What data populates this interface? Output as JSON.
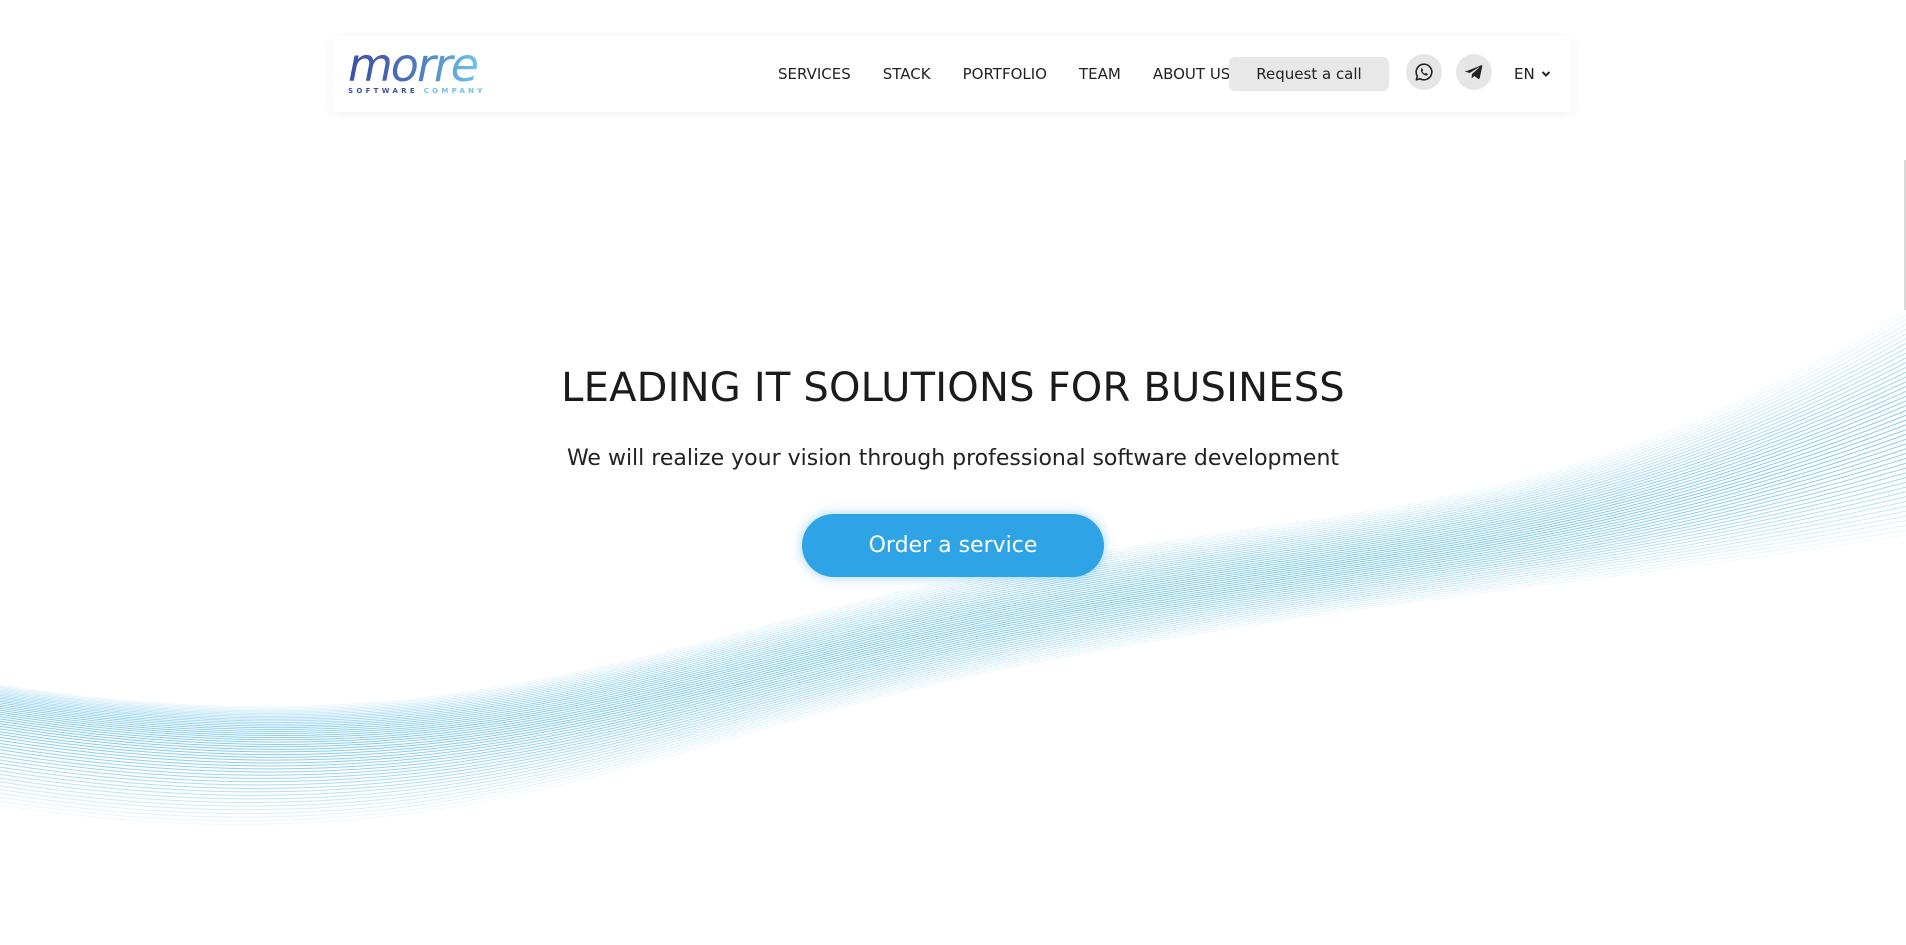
{
  "header": {
    "logo": {
      "word": "morre",
      "tagline_part1": "SOFTWARE",
      "tagline_part2": "COMPANY"
    },
    "nav": [
      {
        "label": "SERVICES"
      },
      {
        "label": "STACK"
      },
      {
        "label": "PORTFOLIO"
      },
      {
        "label": "TEAM"
      },
      {
        "label": "ABOUT US"
      }
    ],
    "request_call_label": "Request a call",
    "icons": {
      "whatsapp": "whatsapp-icon",
      "telegram": "telegram-icon"
    },
    "language": "EN"
  },
  "hero": {
    "title": "LEADING IT SOLUTIONS FOR BUSINESS",
    "subtitle": "We will realize your vision through professional software development",
    "cta_label": "Order a service"
  },
  "colors": {
    "accent": "#2ea4e6",
    "wave": "#4ab3e6",
    "logo_dark": "#3f4fa0",
    "logo_light": "#6dc3e8"
  }
}
